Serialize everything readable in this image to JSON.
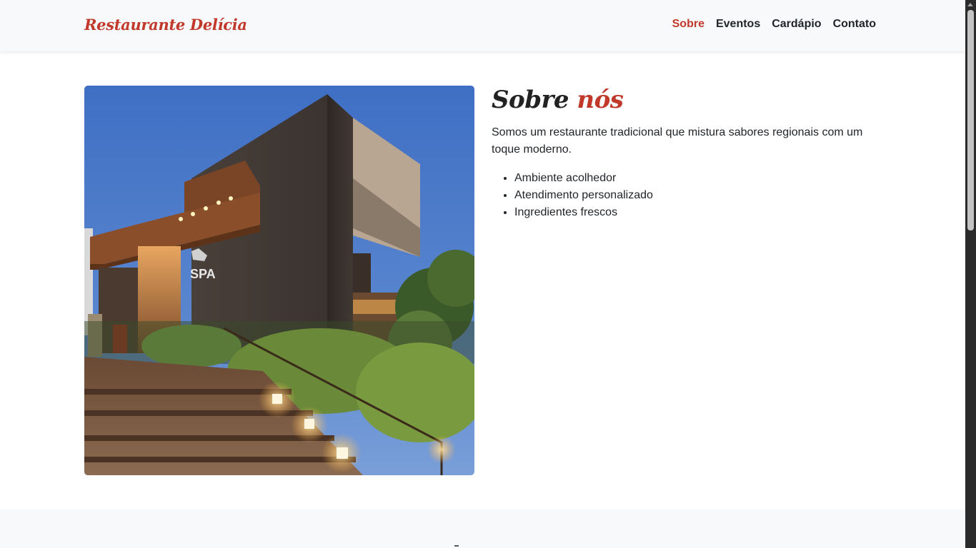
{
  "navbar": {
    "brand": "Restaurante Delícia",
    "links": [
      {
        "label": "Sobre",
        "active": true
      },
      {
        "label": "Eventos",
        "active": false
      },
      {
        "label": "Cardápio",
        "active": false
      },
      {
        "label": "Contato",
        "active": false
      }
    ]
  },
  "about": {
    "title_main": "Sobre ",
    "title_accent": "nós",
    "description": "Somos um restaurante tradicional que mistura sabores regionais com um toque moderno.",
    "features": [
      "Ambiente acolhedor",
      "Atendimento personalizado",
      "Ingredientes frescos"
    ],
    "image_sign_text": "SPA"
  },
  "colors": {
    "accent": "#c0392b",
    "navbar_bg": "#f8f9fa",
    "text": "#212529"
  }
}
